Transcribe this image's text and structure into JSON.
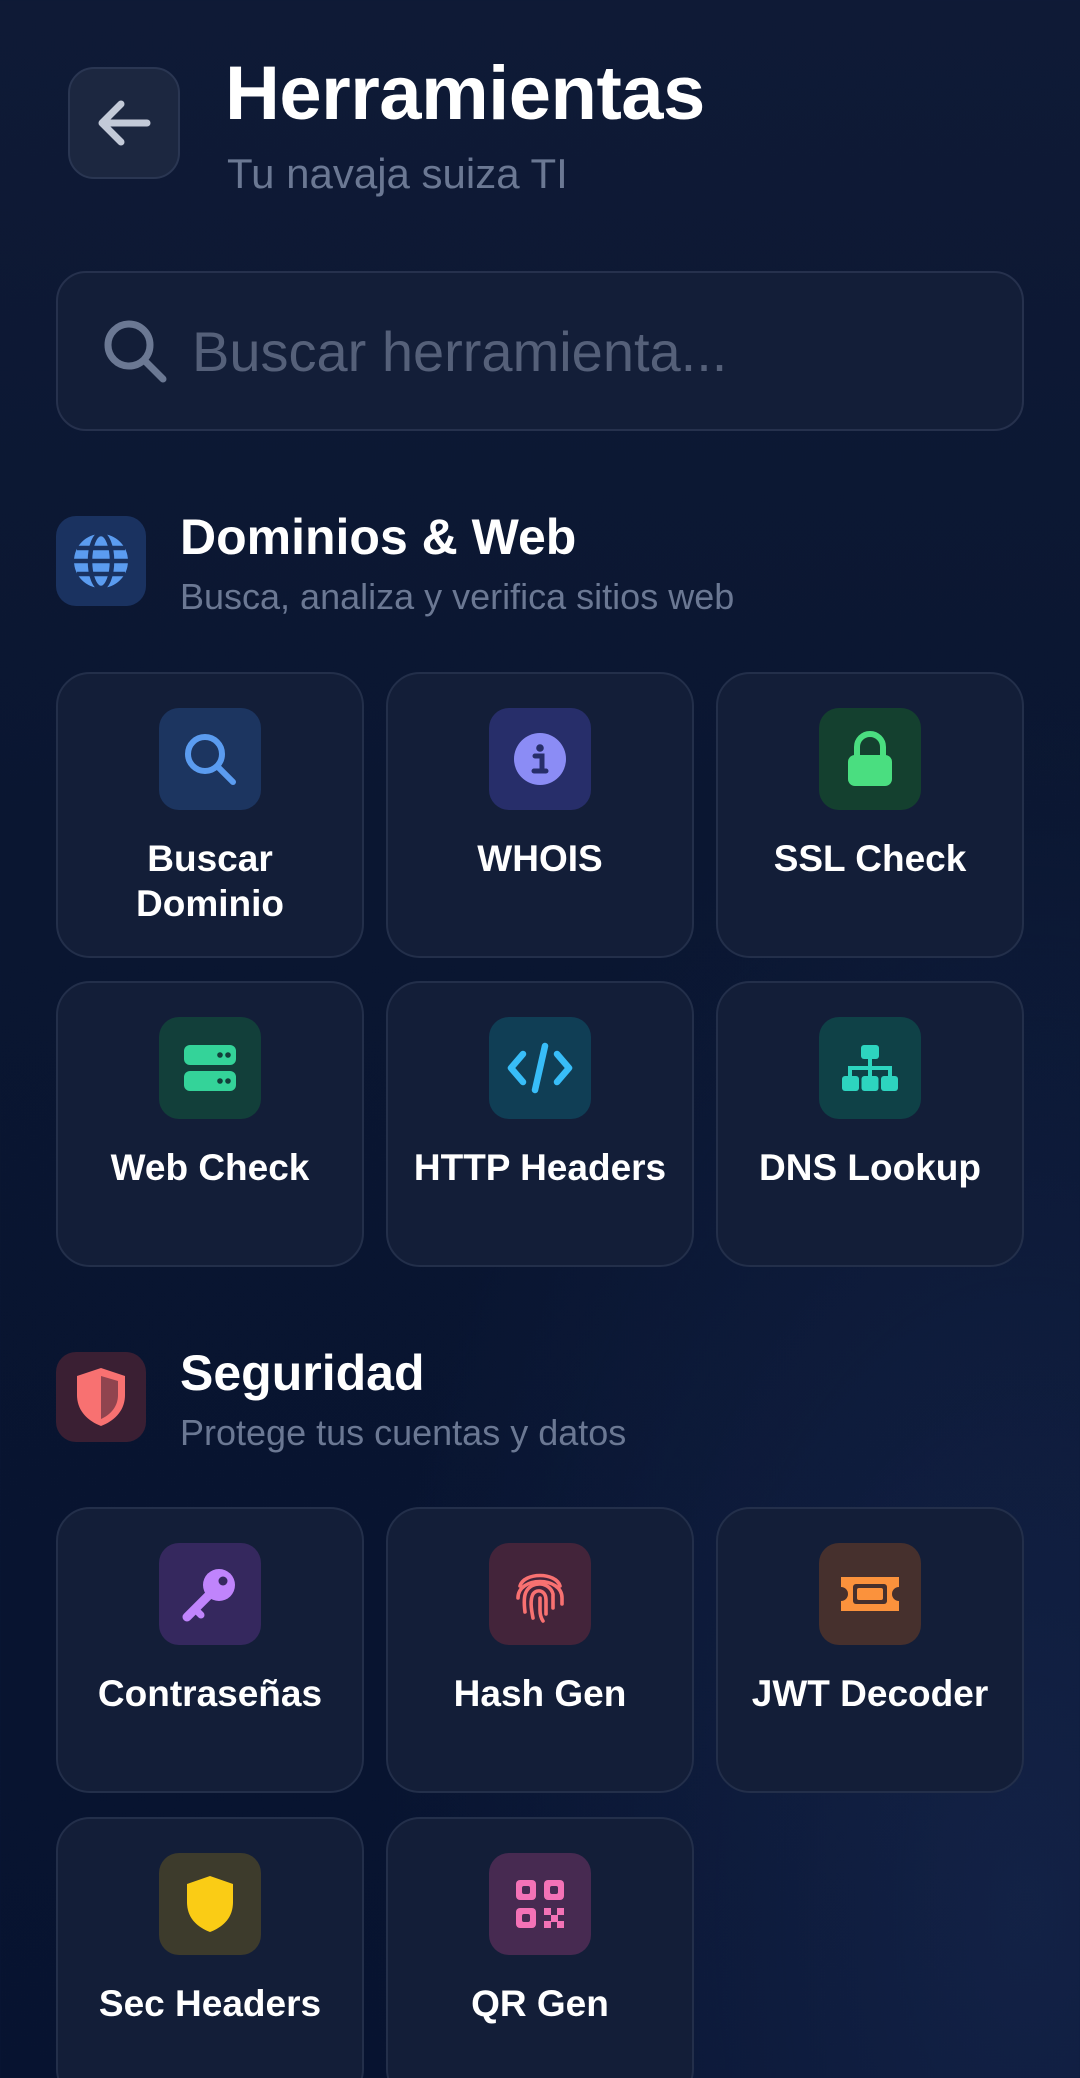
{
  "header": {
    "title": "Herramientas",
    "subtitle": "Tu navaja suiza TI",
    "back_icon": "arrow-left-icon"
  },
  "search": {
    "placeholder": "Buscar herramienta...",
    "value": "",
    "icon": "search-icon"
  },
  "sections": [
    {
      "title": "Dominios & Web",
      "subtitle": "Busca, analiza y verifica sitios web",
      "icon": "globe-icon",
      "color": "#5b9cf0",
      "tools": [
        {
          "label": "Buscar Dominio",
          "icon": "search-icon",
          "color": "#5b9cf0"
        },
        {
          "label": "WHOIS",
          "icon": "info-icon",
          "color": "#8b8cf5"
        },
        {
          "label": "SSL Check",
          "icon": "lock-icon",
          "color": "#4ade80"
        },
        {
          "label": "Web Check",
          "icon": "server-icon",
          "color": "#34d399"
        },
        {
          "label": "HTTP Headers",
          "icon": "code-icon",
          "color": "#38bdf8"
        },
        {
          "label": "DNS Lookup",
          "icon": "sitemap-icon",
          "color": "#2dd4bf"
        }
      ]
    },
    {
      "title": "Seguridad",
      "subtitle": "Protege tus cuentas y datos",
      "icon": "shield-icon",
      "color": "#f87171",
      "tools": [
        {
          "label": "Contraseñas",
          "icon": "key-icon",
          "color": "#c084fc"
        },
        {
          "label": "Hash Gen",
          "icon": "fingerprint-icon",
          "color": "#f87171"
        },
        {
          "label": "JWT Decoder",
          "icon": "ticket-icon",
          "color": "#fb923c"
        },
        {
          "label": "Sec Headers",
          "icon": "shield-icon",
          "color": "#facc15"
        },
        {
          "label": "QR Gen",
          "icon": "qrcode-icon",
          "color": "#f472b6"
        }
      ]
    }
  ]
}
